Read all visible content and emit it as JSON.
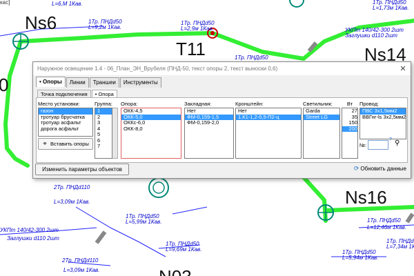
{
  "map": {
    "corner_text": "кас]",
    "stations": {
      "ns6": "Ns6",
      "t11": "T11",
      "ns14": "Ns14",
      "ns16": "Ns16",
      "left_partial": "0",
      "bottom_partial": "N03"
    },
    "cable_labels": {
      "a1": "L=6,M 1Кав.",
      "a2": "1Тр. ПНДd50",
      "a3": "L=9,2м 1Кав.",
      "a4": "1Тр. ПНДd50",
      "a5": "L=2,9м 1Кав.",
      "a6": "1Тр. ПНДd50",
      "a7": "УКПт 140/42-300 2шт",
      "a8": "Заглушки d110 2шт",
      "a9": "1Тр. ПНДd50",
      "a10": "L=1,73м 1Кав.",
      "b1": "2Тр. ПНДd110",
      "b2": "L=3,09м 1Кав.",
      "b3": "1Тр. ПНДd50",
      "b4": "L=5,99м 1Кав.",
      "b5": "1Тр. ПНДd50",
      "b6": "L=9,69м 1Кав.",
      "b7": "УКПт 140/42-300 2шт",
      "b8": "Заглушки d110 2шт",
      "b9": "2Тр. ПНДd110",
      "b10": "L=3,09м 1Кав.",
      "b11": "1Тр. ПНДd50",
      "b12": "L=5,94м 1Кав.",
      "b13": "1Тр. ПНДd50",
      "b14": "L=12,46м 1Кав.",
      "b15": "1Тр. ПНДd50",
      "b16": "L=7,34м 1Кав."
    }
  },
  "dialog": {
    "title": "Наружное освещение 1.4 - 06_План_ЭН_Врубеля   (ПНД-50, текст опоры 2, текст выноски 0,6)",
    "close": "✕",
    "tabs": [
      "• Опоры",
      "Линии",
      "Траншеи",
      "Инструменты"
    ],
    "subtabs": [
      "Точка подключения",
      "• Опора"
    ],
    "place": {
      "header": "Место установки:",
      "items": [
        "газон",
        "тротуар брусчатка",
        "тротуар асфальт",
        "дорога асфальт"
      ],
      "selected": 0
    },
    "group": {
      "header": "Группа:",
      "items": [
        "1",
        "2",
        "3",
        "4",
        "5",
        "6",
        "7"
      ],
      "selected": 0
    },
    "pole": {
      "header": "Опора:",
      "items": [
        "ОКК-4,5",
        "ОКК-5,0",
        "ОККс-6,0",
        "ОКК-8,0"
      ],
      "selected": 1
    },
    "anchor": {
      "header": "Закладная:",
      "items": [
        "Нет",
        "ФМ-0,159-1,5",
        "ФМ-0,159-2,0"
      ],
      "selected": 1
    },
    "bracket": {
      "header": "Кронштейн:",
      "items": [
        "Нет",
        "1.К1-1,2-0,5-П2-ц"
      ],
      "selected": 1
    },
    "lamp": {
      "header": "Светильник:",
      "items": [
        "Garda",
        "Street LG"
      ],
      "selected": 1
    },
    "watt": {
      "header": "Вт",
      "items": [
        "27",
        "35",
        "150",
        "200"
      ],
      "selected": 3
    },
    "wire": {
      "header": "Провод:",
      "items": [
        "ПВС 3х1,5мм2",
        "ВВГнг-ls 3х2,5мм2"
      ],
      "selected": 0
    },
    "num_label": "№:",
    "help_mark": "?",
    "insert_button": "Вставить опоры",
    "change_button": "Изменить параметры объектов",
    "refresh_button": "Обновить данные"
  }
}
